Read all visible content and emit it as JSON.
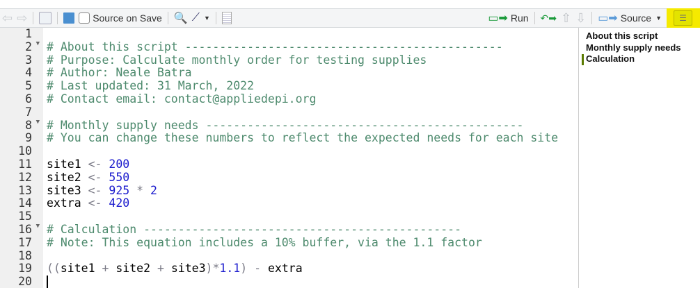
{
  "toolbar": {
    "source_on_save": "Source on Save",
    "run": "Run",
    "source": "Source"
  },
  "outline": {
    "items": [
      {
        "label": "About this script",
        "active": false
      },
      {
        "label": "Monthly supply needs",
        "active": false
      },
      {
        "label": "Calculation",
        "active": true
      }
    ]
  },
  "editor": {
    "folds": [
      2,
      8,
      16
    ],
    "cursor_line": 20,
    "lines": [
      [],
      [
        {
          "t": "# About this script ----------------------------------------------",
          "c": "comment"
        }
      ],
      [
        {
          "t": "# Purpose: Calculate monthly order for testing supplies",
          "c": "comment"
        }
      ],
      [
        {
          "t": "# Author: Neale Batra",
          "c": "comment"
        }
      ],
      [
        {
          "t": "# Last updated: 31 March, 2022",
          "c": "comment"
        }
      ],
      [
        {
          "t": "# Contact email: contact@appliedepi.org",
          "c": "comment"
        }
      ],
      [],
      [
        {
          "t": "# Monthly supply needs ----------------------------------------------",
          "c": "comment"
        }
      ],
      [
        {
          "t": "# You can change these numbers to reflect the expected needs for each site",
          "c": "comment"
        }
      ],
      [],
      [
        {
          "t": "site1 ",
          "c": "id"
        },
        {
          "t": "<-",
          "c": "op"
        },
        {
          "t": " 200",
          "c": "num"
        }
      ],
      [
        {
          "t": "site2 ",
          "c": "id"
        },
        {
          "t": "<-",
          "c": "op"
        },
        {
          "t": " 550",
          "c": "num"
        }
      ],
      [
        {
          "t": "site3 ",
          "c": "id"
        },
        {
          "t": "<-",
          "c": "op"
        },
        {
          "t": " 925",
          "c": "num"
        },
        {
          "t": " * ",
          "c": "op"
        },
        {
          "t": "2",
          "c": "num"
        }
      ],
      [
        {
          "t": "extra ",
          "c": "id"
        },
        {
          "t": "<-",
          "c": "op"
        },
        {
          "t": " 420",
          "c": "num"
        }
      ],
      [],
      [
        {
          "t": "# Calculation ----------------------------------------------",
          "c": "comment"
        }
      ],
      [
        {
          "t": "# Note: This equation includes a 10% buffer, via the 1.1 factor",
          "c": "comment"
        }
      ],
      [],
      [
        {
          "t": "((",
          "c": "op"
        },
        {
          "t": "site1",
          "c": "id"
        },
        {
          "t": " + ",
          "c": "op"
        },
        {
          "t": "site2",
          "c": "id"
        },
        {
          "t": " + ",
          "c": "op"
        },
        {
          "t": "site3",
          "c": "id"
        },
        {
          "t": ")*",
          "c": "op"
        },
        {
          "t": "1.1",
          "c": "num"
        },
        {
          "t": ")",
          "c": "op"
        },
        {
          "t": " - ",
          "c": "op"
        },
        {
          "t": "extra",
          "c": "id"
        }
      ],
      []
    ]
  }
}
